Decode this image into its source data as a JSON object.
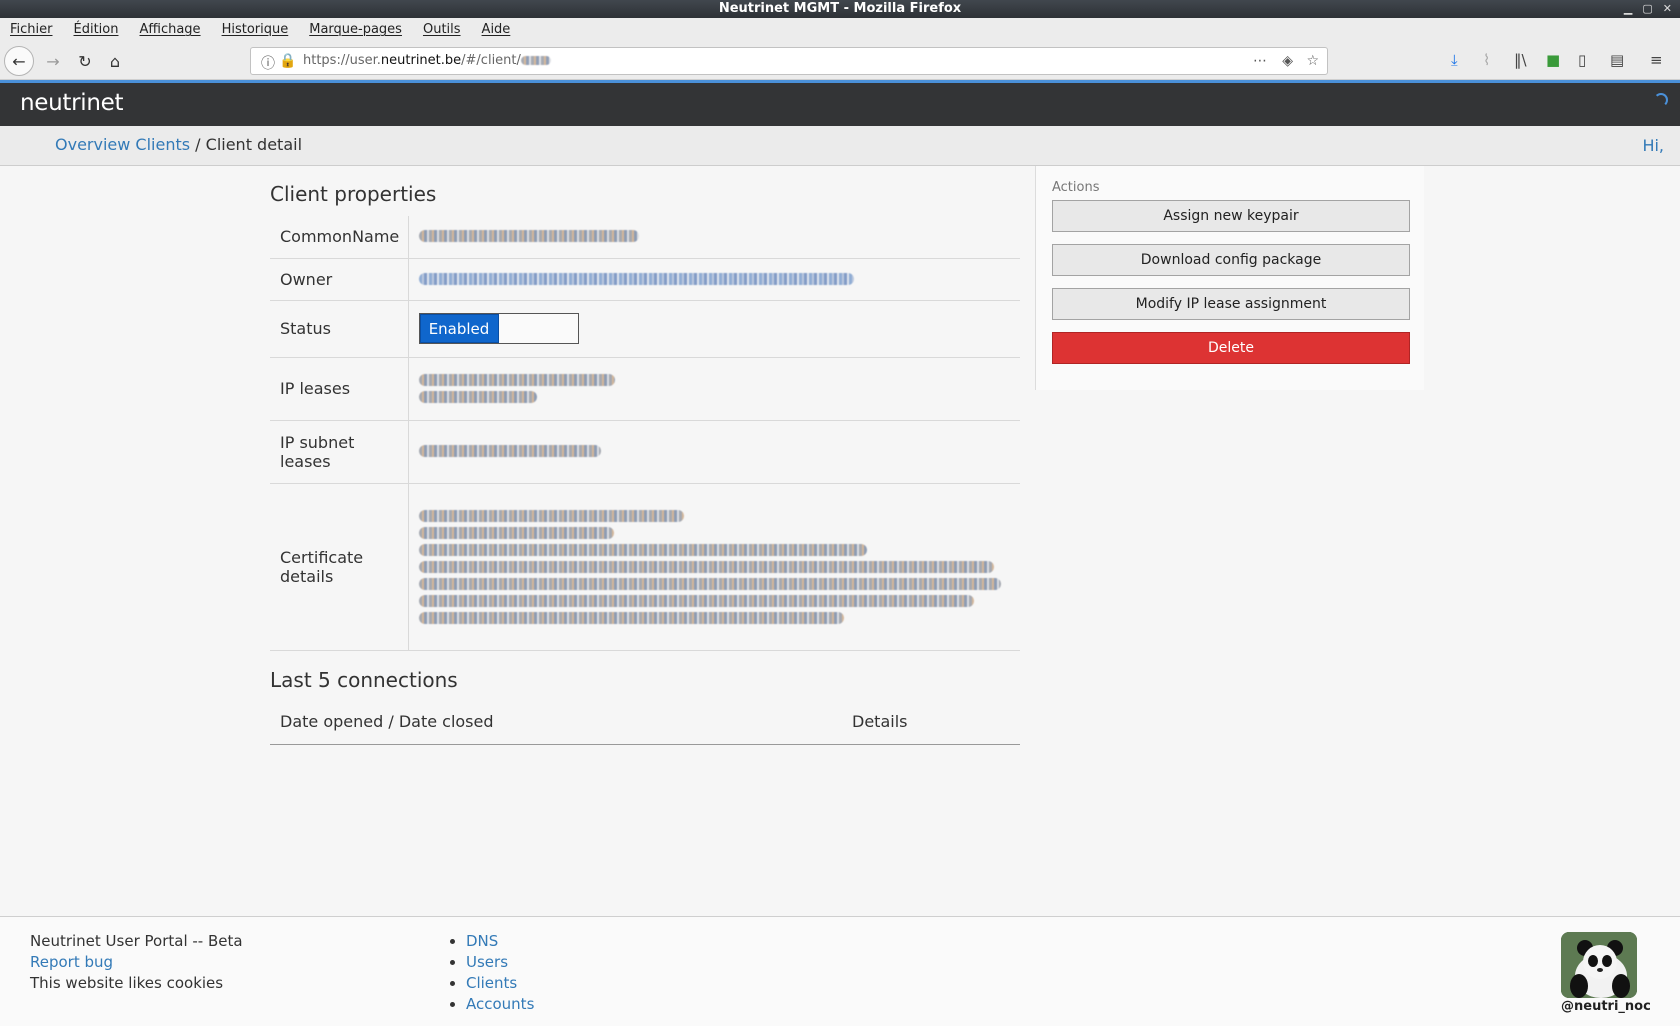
{
  "window": {
    "title": "Neutrinet MGMT - Mozilla Firefox"
  },
  "menu": [
    "Fichier",
    "Édition",
    "Affichage",
    "Historique",
    "Marque-pages",
    "Outils",
    "Aide"
  ],
  "url": {
    "prefix": "https://user.",
    "host": "neutrinet.be",
    "path": "/#/client/"
  },
  "app": {
    "brand": "neutrinet"
  },
  "breadcrumb": {
    "root": "Overview Clients",
    "sep": " / ",
    "current": "Client detail",
    "greeting": "Hi,"
  },
  "props": {
    "title": "Client properties",
    "rows": {
      "common_name": "CommonName",
      "owner": "Owner",
      "status": "Status",
      "ip_leases": "IP leases",
      "ip_subnet_leases": "IP subnet leases",
      "certificate_details": "Certificate details"
    },
    "status_value": "Enabled"
  },
  "connections": {
    "title": "Last 5 connections",
    "col1": "Date opened / Date closed",
    "col2": "Details"
  },
  "actions": {
    "label": "Actions",
    "assign": "Assign new keypair",
    "download": "Download config package",
    "modify": "Modify IP lease assignment",
    "delete": "Delete"
  },
  "footer": {
    "line1": "Neutrinet User Portal -- Beta",
    "report": "Report bug",
    "cookies": "This website likes cookies",
    "links": [
      "DNS",
      "Users",
      "Clients",
      "Accounts"
    ],
    "handle": "@neutri_noc"
  },
  "colors": {
    "accent": "#337ab7",
    "danger": "#dd3333",
    "header": "#333436",
    "toggle_on": "#0f66cc"
  }
}
